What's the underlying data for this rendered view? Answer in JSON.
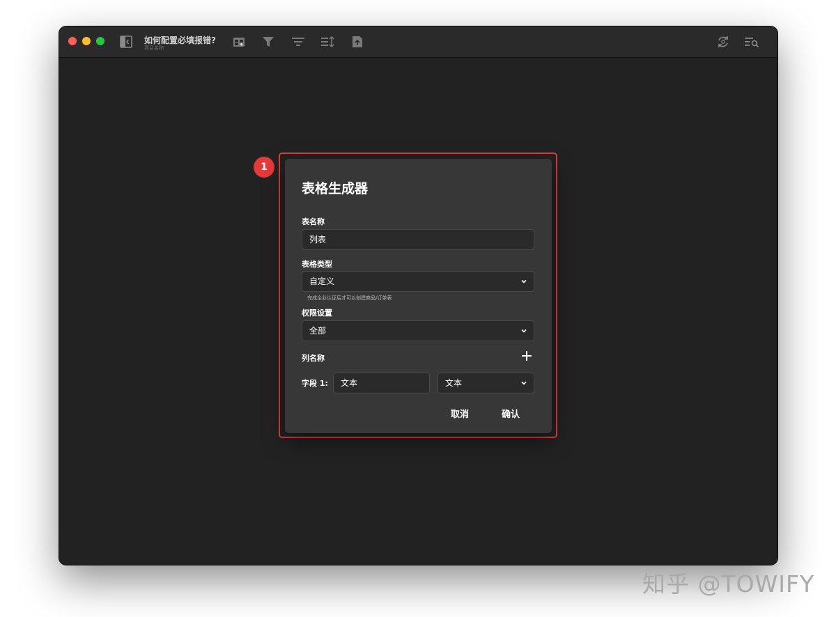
{
  "window": {
    "doc_title": "如何配置必填报错?",
    "doc_subtitle": "项目名称",
    "toolbar_icons": [
      "sidebar-toggle-icon",
      "add-table-icon",
      "filter-icon",
      "group-icon",
      "sort-icon",
      "export-icon",
      "sync-icon",
      "search-list-icon"
    ]
  },
  "annotation": {
    "step": "1",
    "color": "#e53a3a"
  },
  "dialog": {
    "title": "表格生成器",
    "name_label": "表名称",
    "name_value": "列表",
    "type_label": "表格类型",
    "type_value": "自定义",
    "type_hint": "完成企业认证后才可以创建商品/订单表",
    "permission_label": "权限设置",
    "permission_value": "全部",
    "columns_label": "列名称",
    "field_prefix": "字段 1:",
    "field_name_value": "文本",
    "field_type_value": "文本",
    "cancel_label": "取消",
    "confirm_label": "确认"
  },
  "watermark": "知乎 @TOWIFY"
}
